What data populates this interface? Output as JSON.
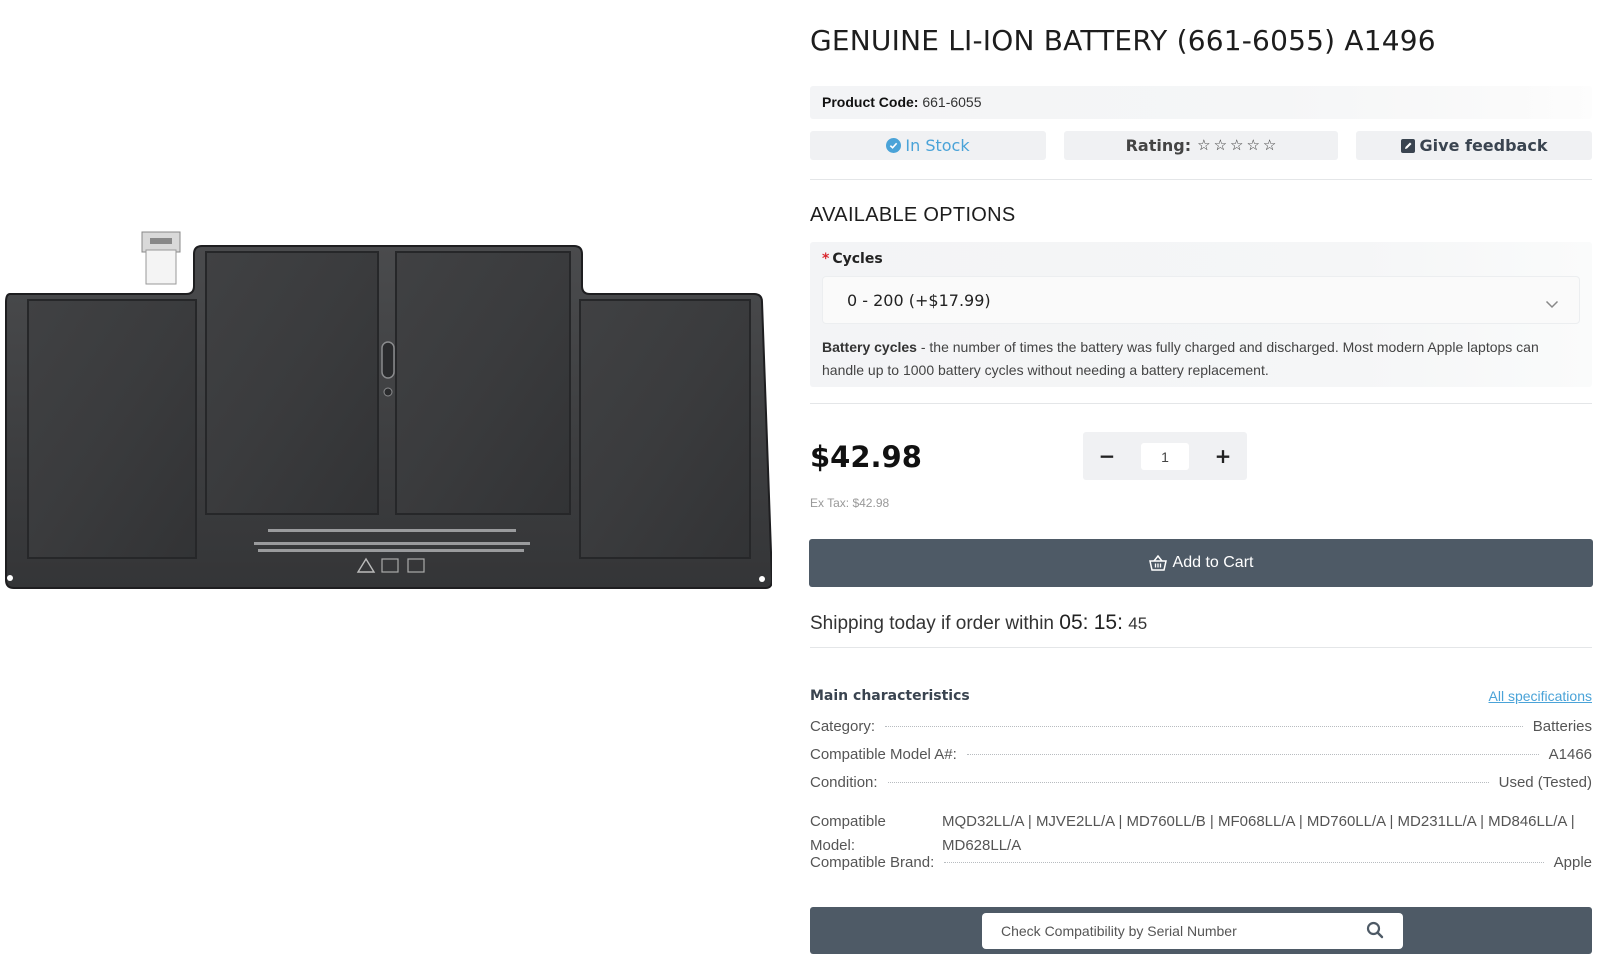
{
  "product": {
    "title": "GENUINE LI-ION BATTERY (661-6055) A1496",
    "code_label": "Product Code:",
    "code_value": "661-6055",
    "image_icon": "battery-product-image"
  },
  "status": {
    "stock_label": "In Stock",
    "stock_icon": "check-circle-icon",
    "rating_label": "Rating:",
    "rating_value": 0,
    "rating_max": 5,
    "feedback_label": "Give feedback",
    "feedback_icon": "edit-square-icon"
  },
  "options": {
    "section_title": "AVAILABLE OPTIONS",
    "required_mark": "*",
    "cycles_label": "Cycles",
    "cycles_selected": "0 - 200 (+$17.99)",
    "help_bold": "Battery cycles",
    "help_text": " - the number of times the battery was fully charged and discharged. Most modern Apple laptops can handle up to 1000 battery cycles without needing a battery replacement."
  },
  "pricing": {
    "price": "$42.98",
    "ex_tax": "Ex Tax: $42.98",
    "qty_minus": "−",
    "qty_plus": "+",
    "qty_value": "1"
  },
  "cart": {
    "add_label": "Add to Cart",
    "icon": "basket-icon"
  },
  "shipping": {
    "text": "Shipping today if order within",
    "hours": "05",
    "minutes": "15",
    "seconds": "45",
    "sep": ":"
  },
  "characteristics": {
    "title": "Main characteristics",
    "all_link": "All specifications",
    "category_label": "Category:",
    "category_value": "Batteries",
    "model_num_label": "Compatible Model A#:",
    "model_num_value": "A1466",
    "condition_label": "Condition:",
    "condition_value": "Used (Tested)",
    "models_label": "Compatible Model:",
    "models_value": "MQD32LL/A | MJVE2LL/A | MD760LL/B | MF068LL/A | MD760LL/A | MD231LL/A | MD846LL/A | MD628LL/A",
    "brand_label": "Compatible Brand:",
    "brand_value": "Apple"
  },
  "compat": {
    "placeholder": "Check Compatibility by Serial Number",
    "search_icon": "search-icon"
  },
  "colors": {
    "accent_blue": "#4aa3d8",
    "bar_dark": "#4e5a66",
    "required_red": "#d9272e"
  }
}
